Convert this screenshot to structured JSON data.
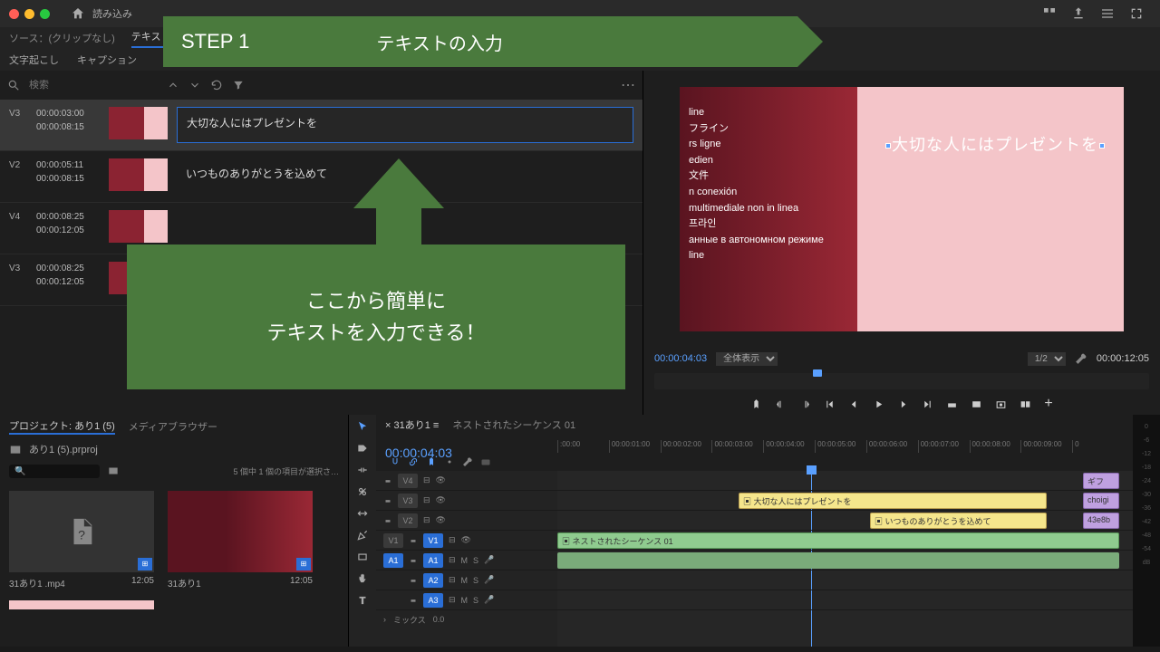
{
  "topbar": {
    "menu": "読み込み"
  },
  "tabs": {
    "source": "ソース：(クリップなし)",
    "text": "テキスト",
    "transcript": "文字起こし",
    "caption": "キャプション"
  },
  "search": {
    "placeholder": "検索"
  },
  "text_rows": [
    {
      "track": "V3",
      "in": "00:00:03:00",
      "out": "00:00:08:15",
      "text": "大切な人にはプレゼントを"
    },
    {
      "track": "V2",
      "in": "00:00:05:11",
      "out": "00:00:08:15",
      "text": "いつものありがとうを込めて"
    },
    {
      "track": "V4",
      "in": "00:00:08:25",
      "out": "00:00:12:05",
      "text": ""
    },
    {
      "track": "V3",
      "in": "00:00:08:25",
      "out": "00:00:12:05",
      "text": ""
    }
  ],
  "monitor": {
    "tc": "00:00:04:03",
    "fit": "全体表示",
    "scale": "1/2",
    "dur": "00:00:12:05",
    "lines": [
      "line",
      "フライン",
      "rs ligne",
      "edien",
      "文件",
      "n conexión",
      "multimediale non in linea",
      "프라인",
      "анные в автономном режиме",
      "line"
    ],
    "overlay": "大切な人にはプレゼントを"
  },
  "project": {
    "tab": "プロジェクト: あり1 (5)",
    "tab2": "メディアブラウザー",
    "file": "あり1 (5).prproj",
    "status": "5 個中 1 個の項目が選択さ…",
    "items": [
      {
        "name": "31あり1 .mp4",
        "dur": "12:05"
      },
      {
        "name": "31あり1",
        "dur": "12:05"
      }
    ]
  },
  "timeline": {
    "seq1": "31あり1",
    "seq2": "ネストされたシーケンス 01",
    "tc": "00:00:04:03",
    "ruler": [
      ":00:00",
      "00:00:01:00",
      "00:00:02:00",
      "00:00:03:00",
      "00:00:04:00",
      "00:00:05:00",
      "00:00:06:00",
      "00:00:07:00",
      "00:00:08:00",
      "00:00:09:00",
      "0"
    ],
    "tracks_v": [
      "V4",
      "V3",
      "V2",
      "V1"
    ],
    "tracks_a": [
      "A1",
      "A2",
      "A3"
    ],
    "mix": "ミックス",
    "mix_val": "0.0",
    "clips": {
      "v4": "ギフ",
      "v3a": "大切な人にはプレゼントを",
      "v3b": "choigi",
      "v2a": "いつものありがとうを込めて",
      "v2b": "43e8b",
      "v1": "ネストされたシーケンス 01"
    }
  },
  "annot": {
    "step": "STEP 1",
    "title": "テキストの入力",
    "arrow1": "ここから簡単に",
    "arrow2": "テキストを入力できる！"
  },
  "meters": [
    "0",
    "-6",
    "-12",
    "-18",
    "-24",
    "-30",
    "-36",
    "-42",
    "-48",
    "-54",
    "dB"
  ]
}
